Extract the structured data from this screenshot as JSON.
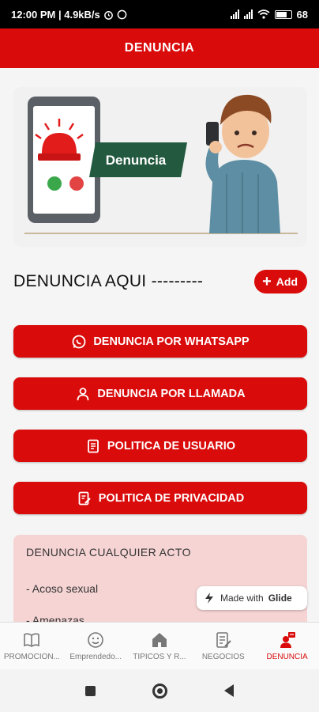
{
  "status_bar": {
    "time_speed": "12:00 PM | 4.9kB/s",
    "battery": "68"
  },
  "header": {
    "title": "DENUNCIA"
  },
  "hero": {
    "sign_text": "Denuncia"
  },
  "section": {
    "title": "DENUNCIA AQUI ---------",
    "add_label": "Add"
  },
  "actions": [
    {
      "label": "DENUNCIA POR WHATSAPP",
      "icon": "whatsapp-icon"
    },
    {
      "label": "DENUNCIA POR LLAMADA",
      "icon": "person-icon"
    },
    {
      "label": "POLITICA DE USUARIO",
      "icon": "document-icon"
    },
    {
      "label": "POLITICA DE PRIVACIDAD",
      "icon": "document-edit-icon"
    }
  ],
  "info": {
    "title": "DENUNCIA CUALQUIER ACTO",
    "items": [
      "- Acoso sexual",
      "- Amenazas"
    ]
  },
  "glide_badge": {
    "text": "Made with",
    "brand": "Glide"
  },
  "nav": [
    {
      "label": "PROMOCION...",
      "icon": "book-icon"
    },
    {
      "label": "Emprendedo...",
      "icon": "smiley-icon"
    },
    {
      "label": "TIPICOS Y R...",
      "icon": "home-icon"
    },
    {
      "label": "NEGOCIOS",
      "icon": "notes-icon"
    },
    {
      "label": "DENUNCIA",
      "icon": "report-icon",
      "active": true
    }
  ],
  "colors": {
    "primary": "#d90b0b",
    "card_bg": "#f6d4d4"
  }
}
